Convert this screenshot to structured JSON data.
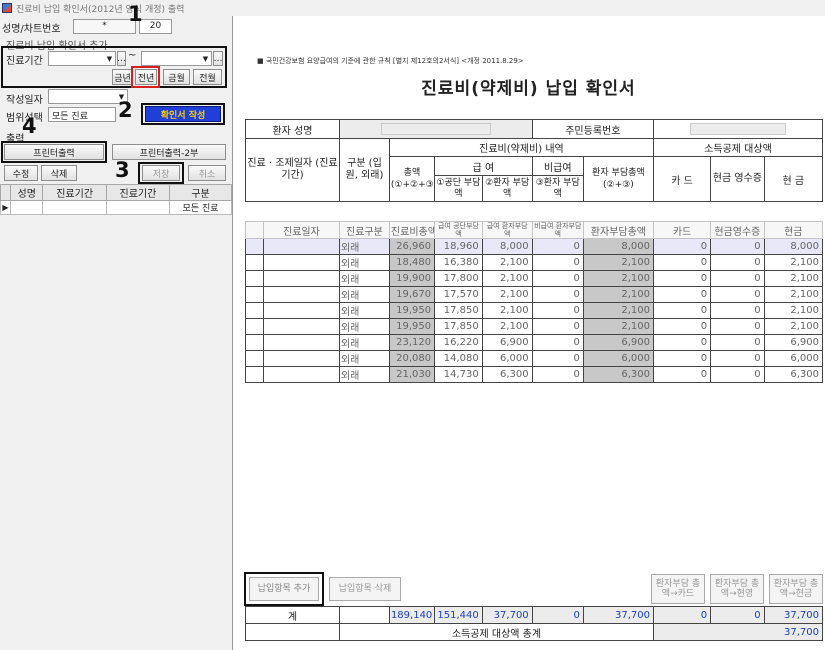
{
  "window": {
    "title": "진료비 납입 확인서(2012년 양식 개정) 출력"
  },
  "left": {
    "name_chart_label": "성명/차트번호",
    "name_chart_value": "*",
    "name_chart_value2": "20",
    "add_section_label": "진료비 납입 확인서 추가",
    "period_label": "진료기간",
    "period_tilde": "~",
    "year_buttons": [
      "금년",
      "전년",
      "금월",
      "전월"
    ],
    "date_label": "작성일자",
    "range_label": "범위선택",
    "range_value": "모든 진료",
    "create_button": "확인서 작성",
    "print_section_label": "출력",
    "print_button": "프린터출력",
    "print2_button": "프린터출력-2부",
    "edit_button": "수정",
    "delete_button": "삭제",
    "save_button": "저장",
    "cancel_button": "취소",
    "grid_headers": [
      "성명",
      "진료기간",
      "진료기간",
      "구분"
    ],
    "grid_row": [
      "",
      "",
      "",
      "모든 진료"
    ],
    "markers": [
      "1",
      "2",
      "3",
      "4"
    ]
  },
  "doc": {
    "header_note": "■ 국민건강보험 요양급여의 기준에 관한 규칙 [별지 제12호의2서식] <개정 2011.8.29>",
    "title": "진료비(약제비) 납입 확인서",
    "patient_name_label": "환자 성명",
    "resident_no_label": "주민등록번호",
    "h_date": "진료 · 조제일자 (진료기간)",
    "h_type": "구분 (입원, 외래)",
    "h_fee": "진료비(약제비) 내역",
    "h_total": "총액 (①+②+③)",
    "h_benefit": "급 여",
    "h_nonbenefit": "비급여",
    "h_patient": "환자 부담총액 (②+③)",
    "h_p1": "①공단 부담액",
    "h_p2": "②환자 부담액",
    "h_p3": "③환자 부담액",
    "h_deduction": "소득공제 대상액",
    "h_card": "카 드",
    "h_cashreceipt": "현금 영수증",
    "h_cash": "현 금",
    "sub_headers": [
      "진료일자",
      "진료구분",
      "진료비총액",
      "급여 공단부담액",
      "급여 환자부담액",
      "비급여 환자부담액",
      "환자부담총액",
      "카드",
      "현금영수증",
      "현금"
    ],
    "rows": [
      [
        "",
        "외래",
        "26,960",
        "18,960",
        "8,000",
        "0",
        "8,000",
        "0",
        "0",
        "8,000"
      ],
      [
        "",
        "외래",
        "18,480",
        "16,380",
        "2,100",
        "0",
        "2,100",
        "0",
        "0",
        "2,100"
      ],
      [
        "",
        "외래",
        "19,900",
        "17,800",
        "2,100",
        "0",
        "2,100",
        "0",
        "0",
        "2,100"
      ],
      [
        "",
        "외래",
        "19,670",
        "17,570",
        "2,100",
        "0",
        "2,100",
        "0",
        "0",
        "2,100"
      ],
      [
        "",
        "외래",
        "19,950",
        "17,850",
        "2,100",
        "0",
        "2,100",
        "0",
        "0",
        "2,100"
      ],
      [
        "",
        "외래",
        "19,950",
        "17,850",
        "2,100",
        "0",
        "2,100",
        "0",
        "0",
        "2,100"
      ],
      [
        "",
        "외래",
        "23,120",
        "16,220",
        "6,900",
        "0",
        "6,900",
        "0",
        "0",
        "6,900"
      ],
      [
        "",
        "외래",
        "20,080",
        "14,080",
        "6,000",
        "0",
        "6,000",
        "0",
        "0",
        "6,000"
      ],
      [
        "",
        "외래",
        "21,030",
        "14,730",
        "6,300",
        "0",
        "6,300",
        "0",
        "0",
        "6,300"
      ]
    ],
    "add_item_button": "납입항목 추가",
    "delete_item_button": "납입항목 삭제",
    "to_card_button": "환자부담 총액→카드",
    "to_cashreceipt_button": "환자부담 총액→현영",
    "to_cash_button": "환자부담 총액→현금",
    "total_label": "계",
    "totals": [
      "189,140",
      "151,440",
      "37,700",
      "0",
      "37,700",
      "0",
      "0",
      "37,700"
    ],
    "deduction_total_label": "소득공제 대상액 총계",
    "deduction_total": "37,700"
  }
}
